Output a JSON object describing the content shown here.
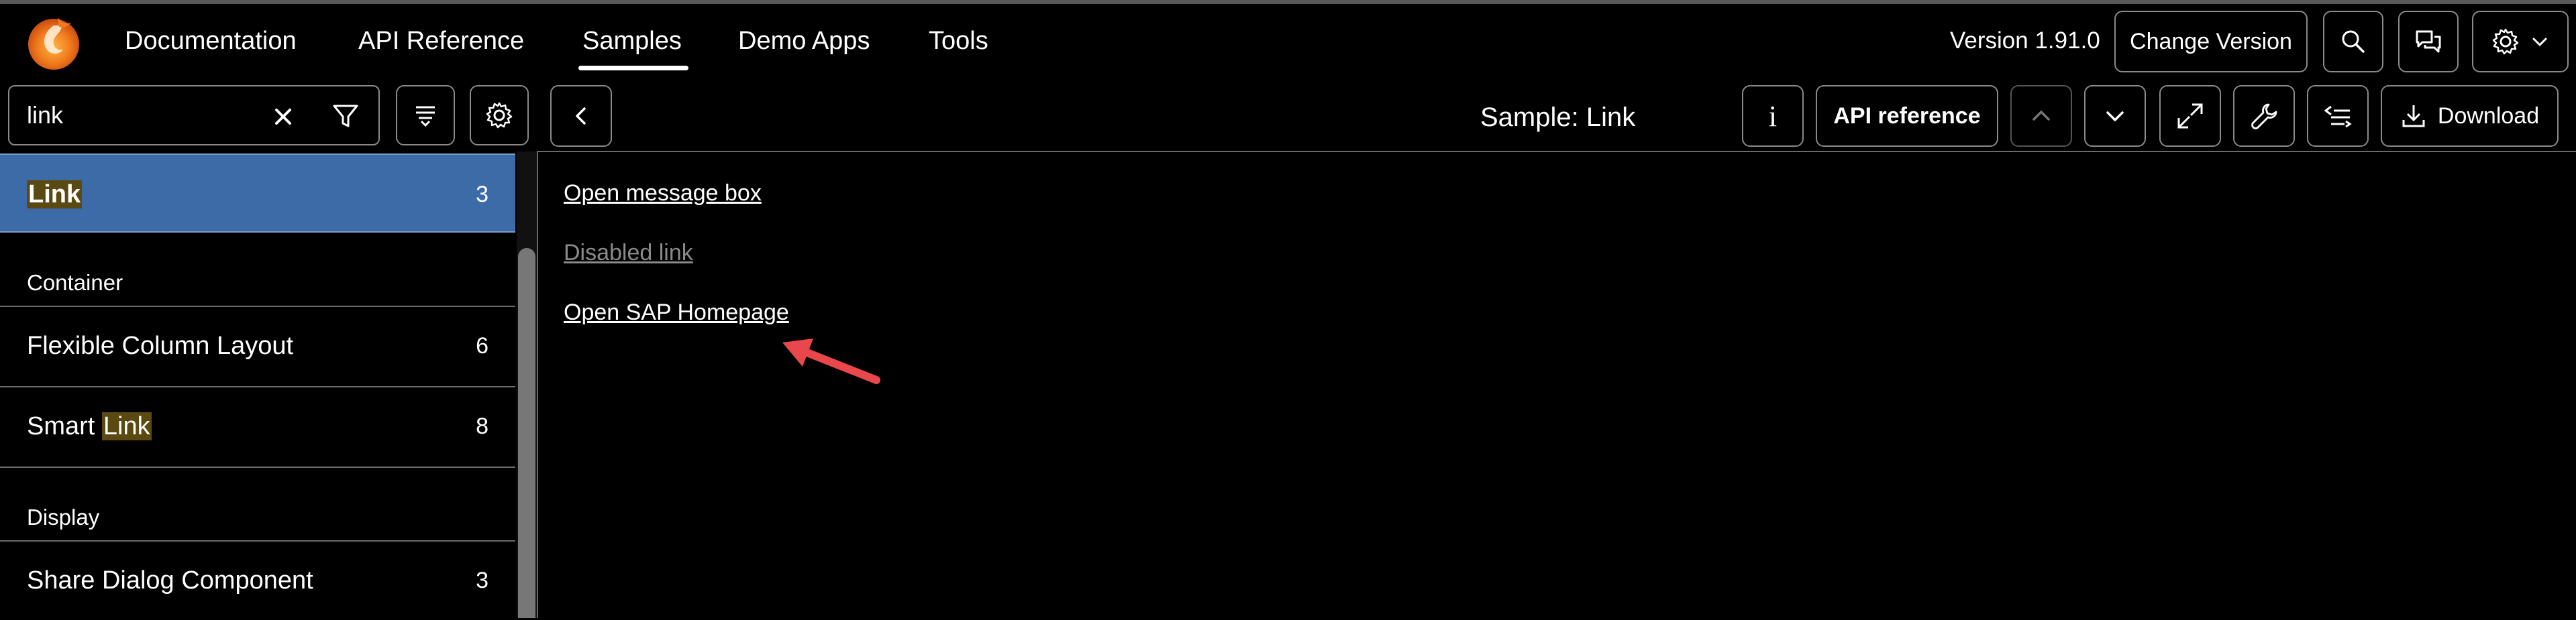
{
  "shellbar": {
    "logo_name": "sap-phoenix-logo",
    "nav": [
      {
        "label": "Documentation"
      },
      {
        "label": "API Reference"
      },
      {
        "label": "Samples",
        "active": true
      },
      {
        "label": "Demo Apps"
      },
      {
        "label": "Tools"
      }
    ],
    "version": "Version 1.91.0",
    "change_version": "Change Version"
  },
  "sidebar": {
    "search_value": "link",
    "selected_item": {
      "label_highlight": "Link",
      "count": "3"
    },
    "groups": [
      {
        "title": "Container",
        "items": [
          {
            "label": "Flexible Column Layout",
            "count": "6"
          },
          {
            "prefix": "Smart ",
            "highlight": "Link",
            "count": "8"
          }
        ]
      },
      {
        "title": "Display",
        "items": [
          {
            "label": "Share Dialog Component",
            "count": "3"
          }
        ]
      }
    ]
  },
  "toolbar": {
    "title": "Sample: Link",
    "api_reference": "API reference",
    "download": "Download"
  },
  "content": {
    "links": [
      {
        "label": "Open message box",
        "enabled": true
      },
      {
        "label": "Disabled link",
        "enabled": false
      },
      {
        "label": "Open SAP Homepage",
        "enabled": true
      }
    ]
  },
  "colors": {
    "selected_bg": "#3d6ba8",
    "highlight_bg": "#5a4a12",
    "annotation_arrow": "#e8474c"
  }
}
